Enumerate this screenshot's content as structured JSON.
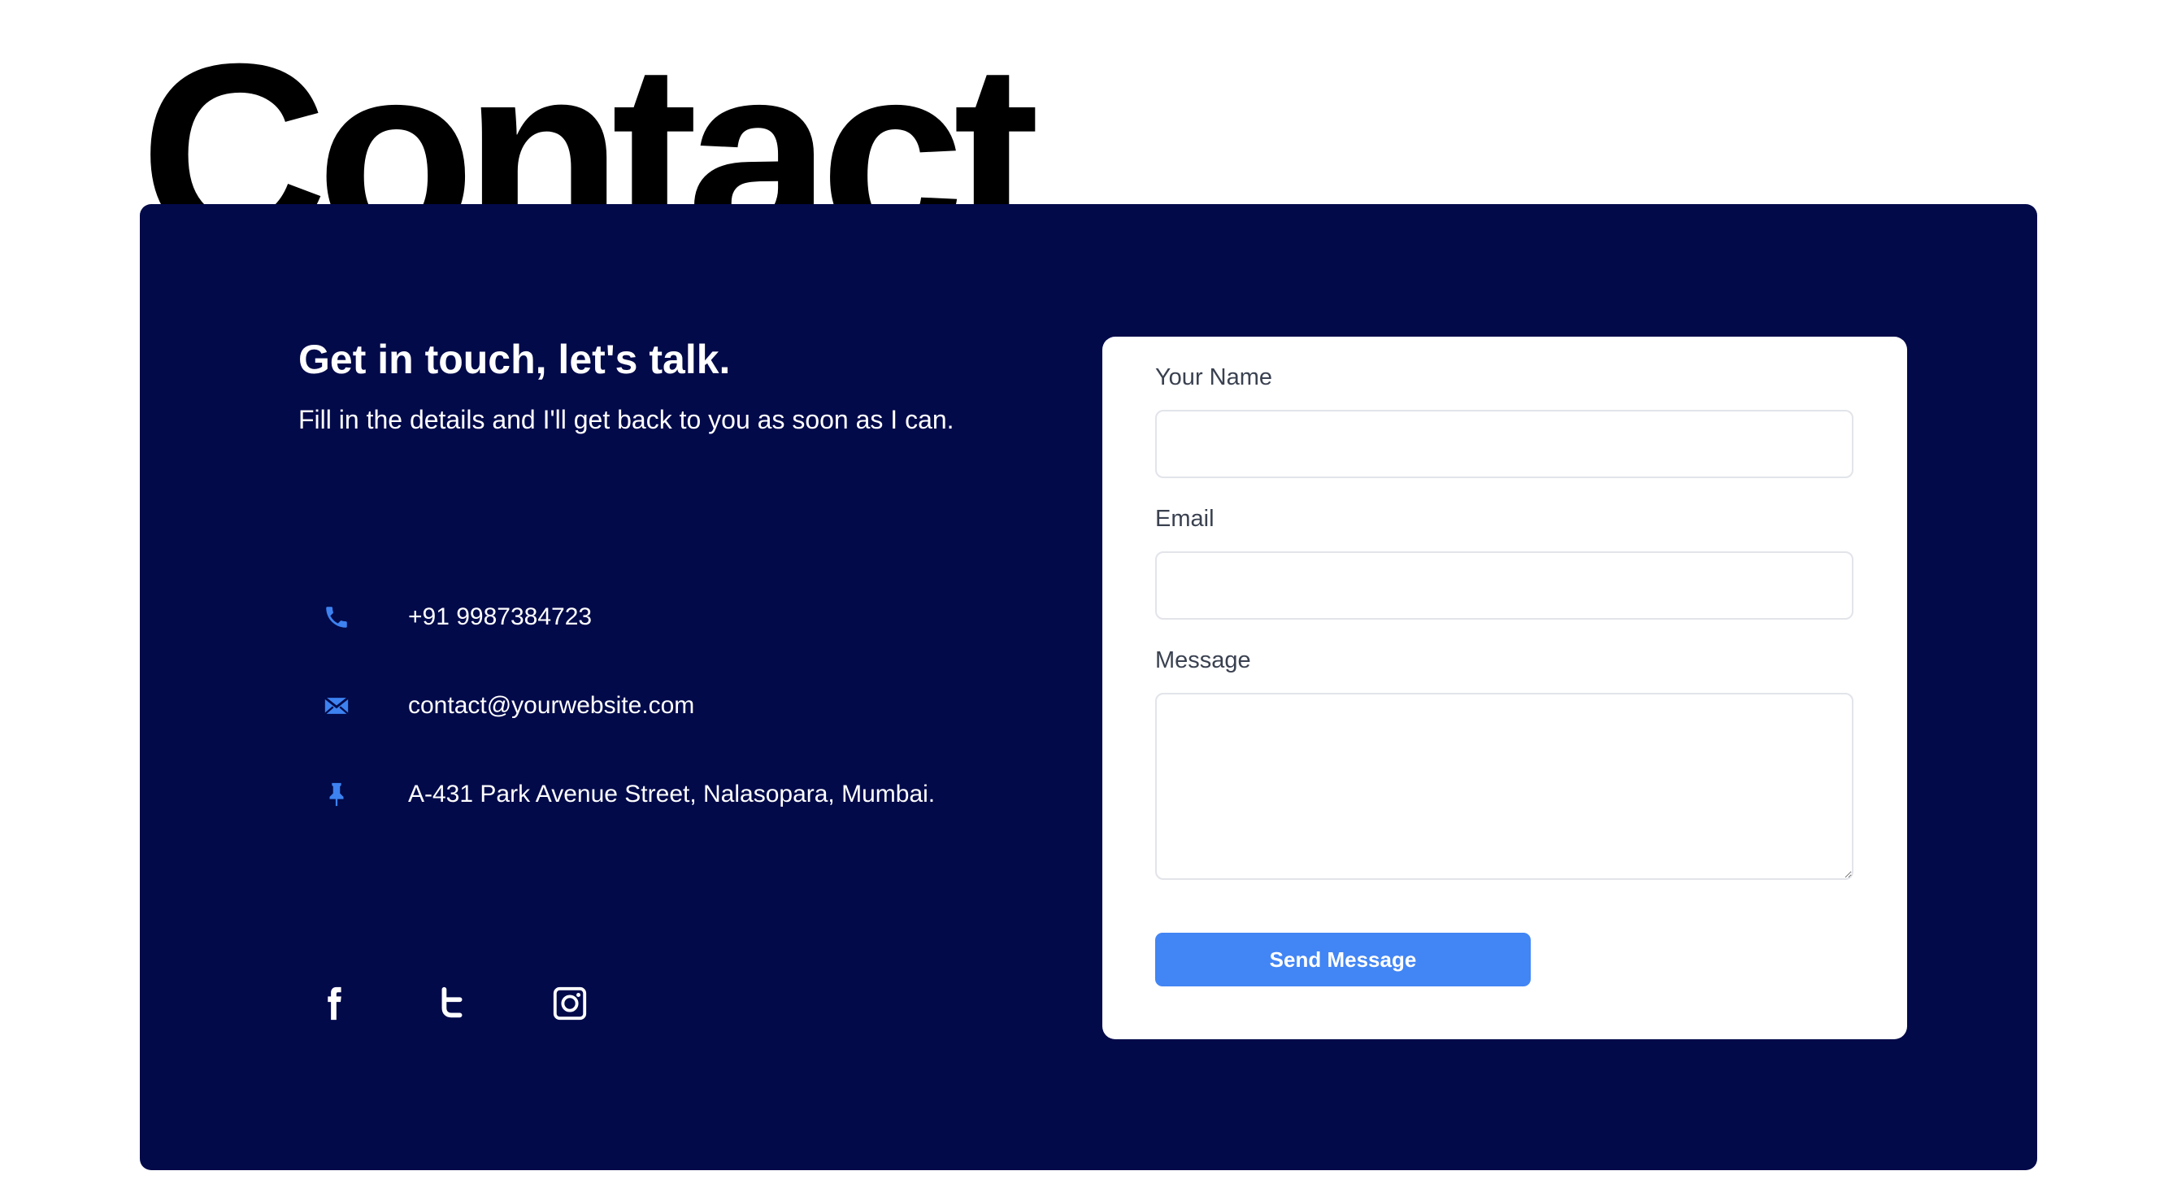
{
  "page": {
    "title": "Contact"
  },
  "intro": {
    "heading": "Get in touch, let's talk.",
    "subtext": "Fill in the details and I'll get back to you as soon as I can."
  },
  "contact_info": {
    "phone": "+91 9987384723",
    "email": "contact@yourwebsite.com",
    "address": "A-431 Park Avenue Street, Nalasopara, Mumbai."
  },
  "icons": {
    "phone": "phone-icon",
    "email": "envelope-icon",
    "address": "pin-icon",
    "accent_color": "#3d82f0"
  },
  "social": [
    {
      "name": "facebook-icon"
    },
    {
      "name": "twitter-icon"
    },
    {
      "name": "instagram-icon"
    }
  ],
  "form": {
    "name_label": "Your Name",
    "name_value": "",
    "email_label": "Email",
    "email_value": "",
    "message_label": "Message",
    "message_value": "",
    "submit_label": "Send Message"
  },
  "colors": {
    "panel_background": "#020a4a",
    "button": "#4285f4",
    "title": "#000000"
  }
}
